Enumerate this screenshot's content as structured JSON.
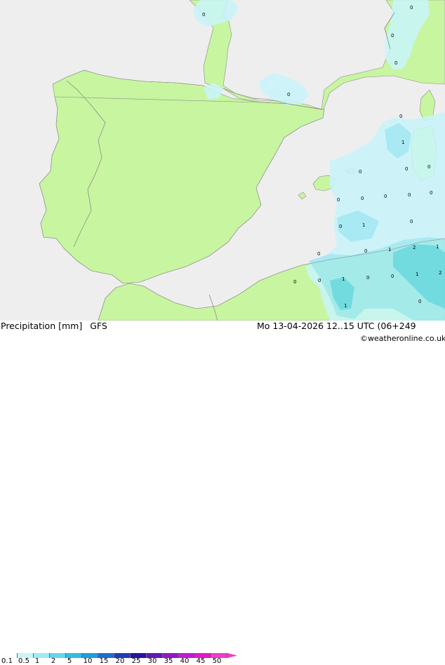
{
  "footer": {
    "title_left": "Precipitation [mm]",
    "model": "GFS",
    "datetime": "Mo 13-04-2026 12..15 UTC (06+249",
    "credit": "©weatheronline.co.uk"
  },
  "legend": {
    "ticks": [
      "0.1",
      "0.5",
      "1",
      "2",
      "5",
      "10",
      "15",
      "20",
      "25",
      "30",
      "35",
      "40",
      "45",
      "50"
    ],
    "colors": [
      "#ffffff",
      "#c8f5fa",
      "#9ee9f5",
      "#64d7ec",
      "#32bde2",
      "#1e9ede",
      "#1e6ed2",
      "#1e3cbe",
      "#2814a0",
      "#6414be",
      "#9614d2",
      "#c814dc",
      "#e614d2",
      "#f03cc8"
    ]
  },
  "map": {
    "colors": {
      "sea": "#eeeeee",
      "land": "#c8f5a0",
      "border": "#8c8c8c",
      "precip_light": "#c8f5fa",
      "precip_mid": "#9ee9f5",
      "precip_strong": "#64d7ec"
    },
    "contour_labels": [
      "0",
      "0",
      "0",
      "0",
      "0",
      "0",
      "0",
      "0",
      "0",
      "1",
      "0",
      "0",
      "0",
      "0",
      "0",
      "0",
      "1",
      "0",
      "0",
      "1",
      "2",
      "1",
      "0",
      "0",
      "1",
      "0",
      "0",
      "1",
      "2",
      "0",
      "1",
      "0"
    ]
  }
}
